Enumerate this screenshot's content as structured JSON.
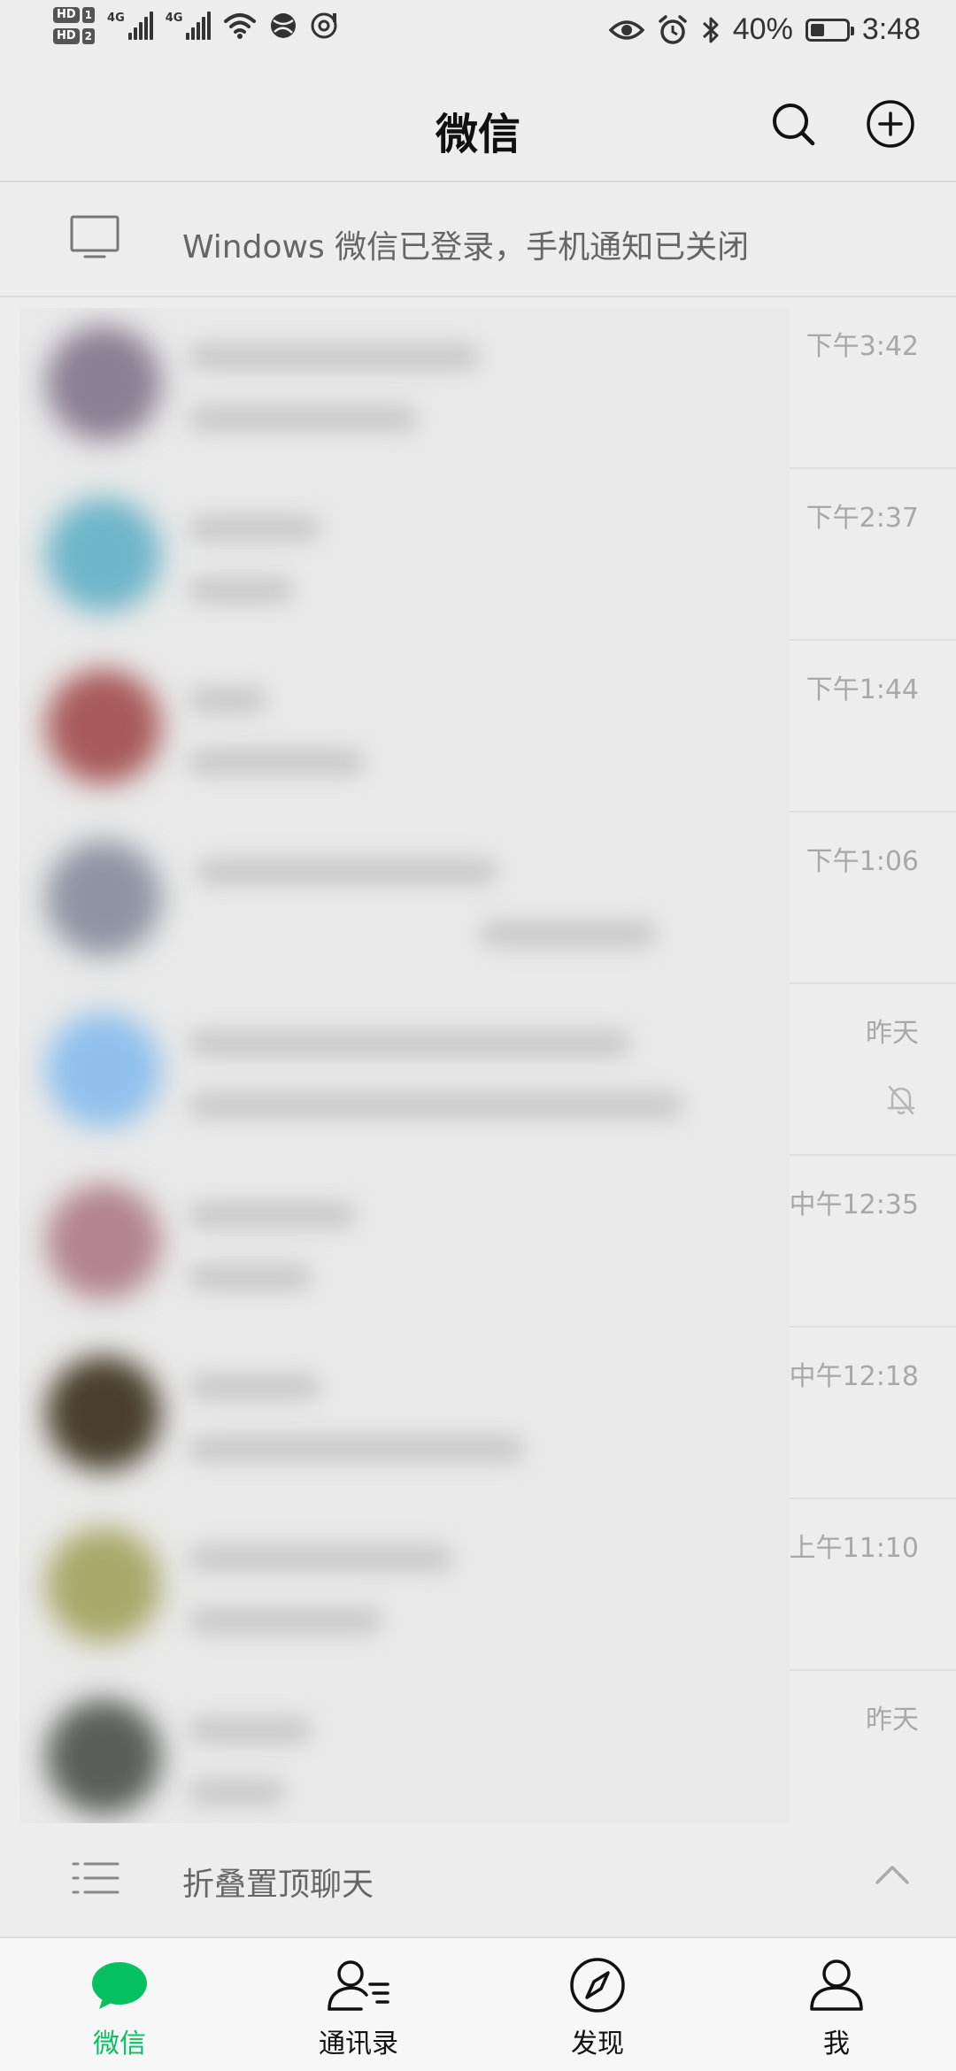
{
  "status_bar": {
    "hd1_label": "HD",
    "hd1_num": "1",
    "hd2_label": "HD",
    "hd2_num": "2",
    "network1": "4G",
    "network2": "4G",
    "battery_percent": "40%",
    "battery_level": 0.4,
    "clock": "3:48"
  },
  "header": {
    "title": "微信"
  },
  "login_banner": {
    "text": "Windows 微信已登录，手机通知已关闭"
  },
  "chats": [
    {
      "time": "下午3:42",
      "muted": false,
      "avatar_color": "#8a7f93"
    },
    {
      "time": "下午2:37",
      "muted": false,
      "avatar_color": "#6fb5c9"
    },
    {
      "time": "下午1:44",
      "muted": false,
      "avatar_color": "#a85a5a"
    },
    {
      "time": "下午1:06",
      "muted": false,
      "avatar_color": "#8f94a3"
    },
    {
      "time": "昨天",
      "muted": true,
      "avatar_color": "#8fc0ec"
    },
    {
      "time": "中午12:35",
      "muted": false,
      "avatar_color": "#b2848f"
    },
    {
      "time": "中午12:18",
      "muted": false,
      "avatar_color": "#4a3f2c"
    },
    {
      "time": "上午11:10",
      "muted": false,
      "avatar_color": "#a8a86a"
    },
    {
      "time": "昨天",
      "muted": false,
      "avatar_color": "#5b5f5a"
    }
  ],
  "fold_bar": {
    "text": "折叠置顶聊天"
  },
  "tabs": [
    {
      "label": "微信",
      "icon": "chat-bubble-icon",
      "active": true
    },
    {
      "label": "通讯录",
      "icon": "contacts-icon",
      "active": false
    },
    {
      "label": "发现",
      "icon": "compass-icon",
      "active": false
    },
    {
      "label": "我",
      "icon": "person-icon",
      "active": false
    }
  ],
  "colors": {
    "accent": "#07c160",
    "background": "#ededed",
    "time_text": "#a8a8a8"
  }
}
